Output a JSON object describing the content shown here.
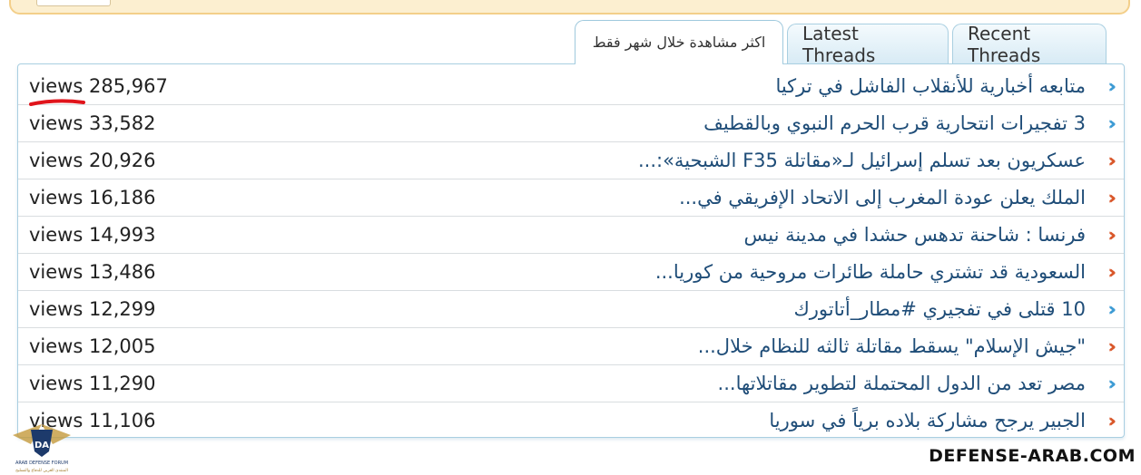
{
  "tabs": {
    "most_viewed": "اكثر مشاهدة خلال شهر فقط",
    "latest": "Latest Threads",
    "recent": "Recent Threads"
  },
  "threads": [
    {
      "title": "متابعه أخبارية للأنقلاب الفاشل في تركيا",
      "views": "views 285,967",
      "icon": "blue"
    },
    {
      "title": "3 تفجيرات انتحارية قرب الحرم النبوي وبالقطيف",
      "views": "views 33,582",
      "icon": "blue"
    },
    {
      "title": "عسكريون بعد تسلم إسرائيل لـ«مقاتلة F35 الشبحية»:...",
      "views": "views 20,926",
      "icon": "orange"
    },
    {
      "title": "الملك يعلن عودة المغرب إلى الاتحاد الإفريقي في...",
      "views": "views 16,186",
      "icon": "orange"
    },
    {
      "title": "فرنسا : شاحنة تدهس حشدا في مدينة نيس",
      "views": "views 14,993",
      "icon": "orange"
    },
    {
      "title": "السعودية قد تشتري حاملة طائرات مروحية من كوريا...",
      "views": "views 13,486",
      "icon": "orange"
    },
    {
      "title": "10 قتلى في تفجيري #مطار_أتاتورك",
      "views": "views 12,299",
      "icon": "blue"
    },
    {
      "title": "\"جيش الإسلام\" يسقط مقاتلة ثالثه للنظام خلال...",
      "views": "views 12,005",
      "icon": "orange"
    },
    {
      "title": "مصر تعد من الدول المحتملة لتطوير مقاتلاتها...",
      "views": "views 11,290",
      "icon": "blue"
    },
    {
      "title": "الجبير يرجح مشاركة بلاده برياً في سوريا",
      "views": "views 11,106",
      "icon": "orange"
    }
  ],
  "icon_colors": {
    "blue": "#3d9bd4",
    "orange": "#d9572a"
  },
  "watermark": {
    "site": "DEFENSE-ARAB.COM",
    "logo_abbrev": "DA",
    "logo_en": "ARAB DEFENSE FORUM",
    "logo_ar": "المنتدى العربي للدفاع والتسليح"
  }
}
